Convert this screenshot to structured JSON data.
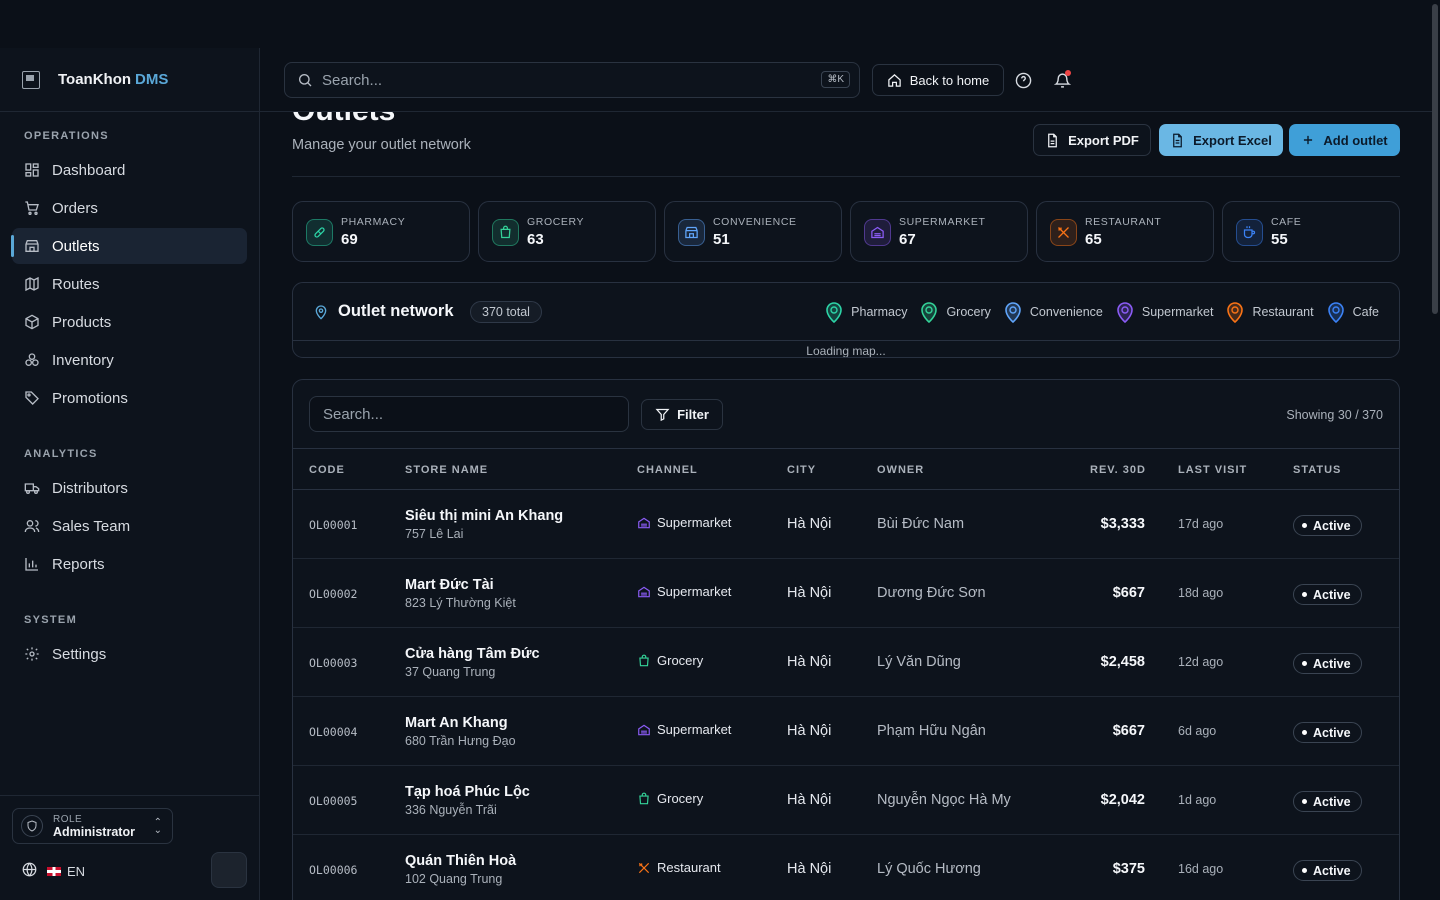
{
  "brand": {
    "name": "ToanKhon",
    "accent": "DMS"
  },
  "sidebar": {
    "sections": [
      {
        "title": "OPERATIONS",
        "items": [
          {
            "label": "Dashboard",
            "icon": "dashboard-icon"
          },
          {
            "label": "Orders",
            "icon": "cart-icon"
          },
          {
            "label": "Outlets",
            "icon": "store-icon",
            "active": true
          },
          {
            "label": "Routes",
            "icon": "map-icon"
          },
          {
            "label": "Products",
            "icon": "box-icon"
          },
          {
            "label": "Inventory",
            "icon": "boxes-icon"
          },
          {
            "label": "Promotions",
            "icon": "tag-icon"
          }
        ]
      },
      {
        "title": "ANALYTICS",
        "items": [
          {
            "label": "Distributors",
            "icon": "truck-icon"
          },
          {
            "label": "Sales Team",
            "icon": "users-icon"
          },
          {
            "label": "Reports",
            "icon": "chart-icon"
          }
        ]
      },
      {
        "title": "SYSTEM",
        "items": [
          {
            "label": "Settings",
            "icon": "gear-icon"
          }
        ]
      }
    ],
    "role": {
      "label": "ROLE",
      "value": "Administrator"
    },
    "language": "EN"
  },
  "topbar": {
    "search_placeholder": "Search...",
    "shortcut": "⌘K",
    "back_label": "Back to home"
  },
  "page": {
    "title": "Outlets",
    "subtitle": "Manage your outlet network",
    "export_pdf": "Export PDF",
    "export_excel": "Export Excel",
    "add_outlet": "Add outlet"
  },
  "channel_cards": [
    {
      "label": "PHARMACY",
      "value": "69",
      "color": "#2dd4a7"
    },
    {
      "label": "GROCERY",
      "value": "63",
      "color": "#34d399"
    },
    {
      "label": "CONVENIENCE",
      "value": "51",
      "color": "#60a5fa"
    },
    {
      "label": "SUPERMARKET",
      "value": "67",
      "color": "#8b5cf6"
    },
    {
      "label": "RESTAURANT",
      "value": "65",
      "color": "#f97316"
    },
    {
      "label": "CAFE",
      "value": "55",
      "color": "#3b82f6"
    }
  ],
  "map": {
    "title": "Outlet network",
    "total": "370 total",
    "legend": [
      {
        "label": "Pharmacy",
        "color": "#2dd4a7"
      },
      {
        "label": "Grocery",
        "color": "#34d399"
      },
      {
        "label": "Convenience",
        "color": "#60a5fa"
      },
      {
        "label": "Supermarket",
        "color": "#8b5cf6"
      },
      {
        "label": "Restaurant",
        "color": "#f97316"
      },
      {
        "label": "Cafe",
        "color": "#3b82f6"
      }
    ],
    "loading": "Loading map..."
  },
  "table": {
    "search_placeholder": "Search...",
    "filter_label": "Filter",
    "showing": "Showing 30 / 370",
    "columns": {
      "code": "CODE",
      "name": "STORE NAME",
      "channel": "CHANNEL",
      "city": "CITY",
      "owner": "OWNER",
      "rev": "REV. 30D",
      "visit": "LAST VISIT",
      "status": "STATUS"
    },
    "rows": [
      {
        "code": "OL00001",
        "name": "Siêu thị mini An Khang",
        "address": "757 Lê Lai",
        "channel": "Supermarket",
        "channel_color": "#8b5cf6",
        "city": "Hà Nội",
        "owner": "Bùi Đức Nam",
        "rev": "$3,333",
        "visit": "17d ago",
        "status": "Active"
      },
      {
        "code": "OL00002",
        "name": "Mart Đức Tài",
        "address": "823 Lý Thường Kiệt",
        "channel": "Supermarket",
        "channel_color": "#8b5cf6",
        "city": "Hà Nội",
        "owner": "Dương Đức Sơn",
        "rev": "$667",
        "visit": "18d ago",
        "status": "Active"
      },
      {
        "code": "OL00003",
        "name": "Cửa hàng Tâm Đức",
        "address": "37 Quang Trung",
        "channel": "Grocery",
        "channel_color": "#34d399",
        "city": "Hà Nội",
        "owner": "Lý Văn Dũng",
        "rev": "$2,458",
        "visit": "12d ago",
        "status": "Active"
      },
      {
        "code": "OL00004",
        "name": "Mart An Khang",
        "address": "680 Trần Hưng Đạo",
        "channel": "Supermarket",
        "channel_color": "#8b5cf6",
        "city": "Hà Nội",
        "owner": "Phạm Hữu Ngân",
        "rev": "$667",
        "visit": "6d ago",
        "status": "Active"
      },
      {
        "code": "OL00005",
        "name": "Tạp hoá Phúc Lộc",
        "address": "336 Nguyễn Trãi",
        "channel": "Grocery",
        "channel_color": "#34d399",
        "city": "Hà Nội",
        "owner": "Nguyễn Ngọc Hà My",
        "rev": "$2,042",
        "visit": "1d ago",
        "status": "Active"
      },
      {
        "code": "OL00006",
        "name": "Quán Thiên Hoà",
        "address": "102 Quang Trung",
        "channel": "Restaurant",
        "channel_color": "#f97316",
        "city": "Hà Nội",
        "owner": "Lý Quốc Hương",
        "rev": "$375",
        "visit": "16d ago",
        "status": "Active"
      }
    ]
  }
}
